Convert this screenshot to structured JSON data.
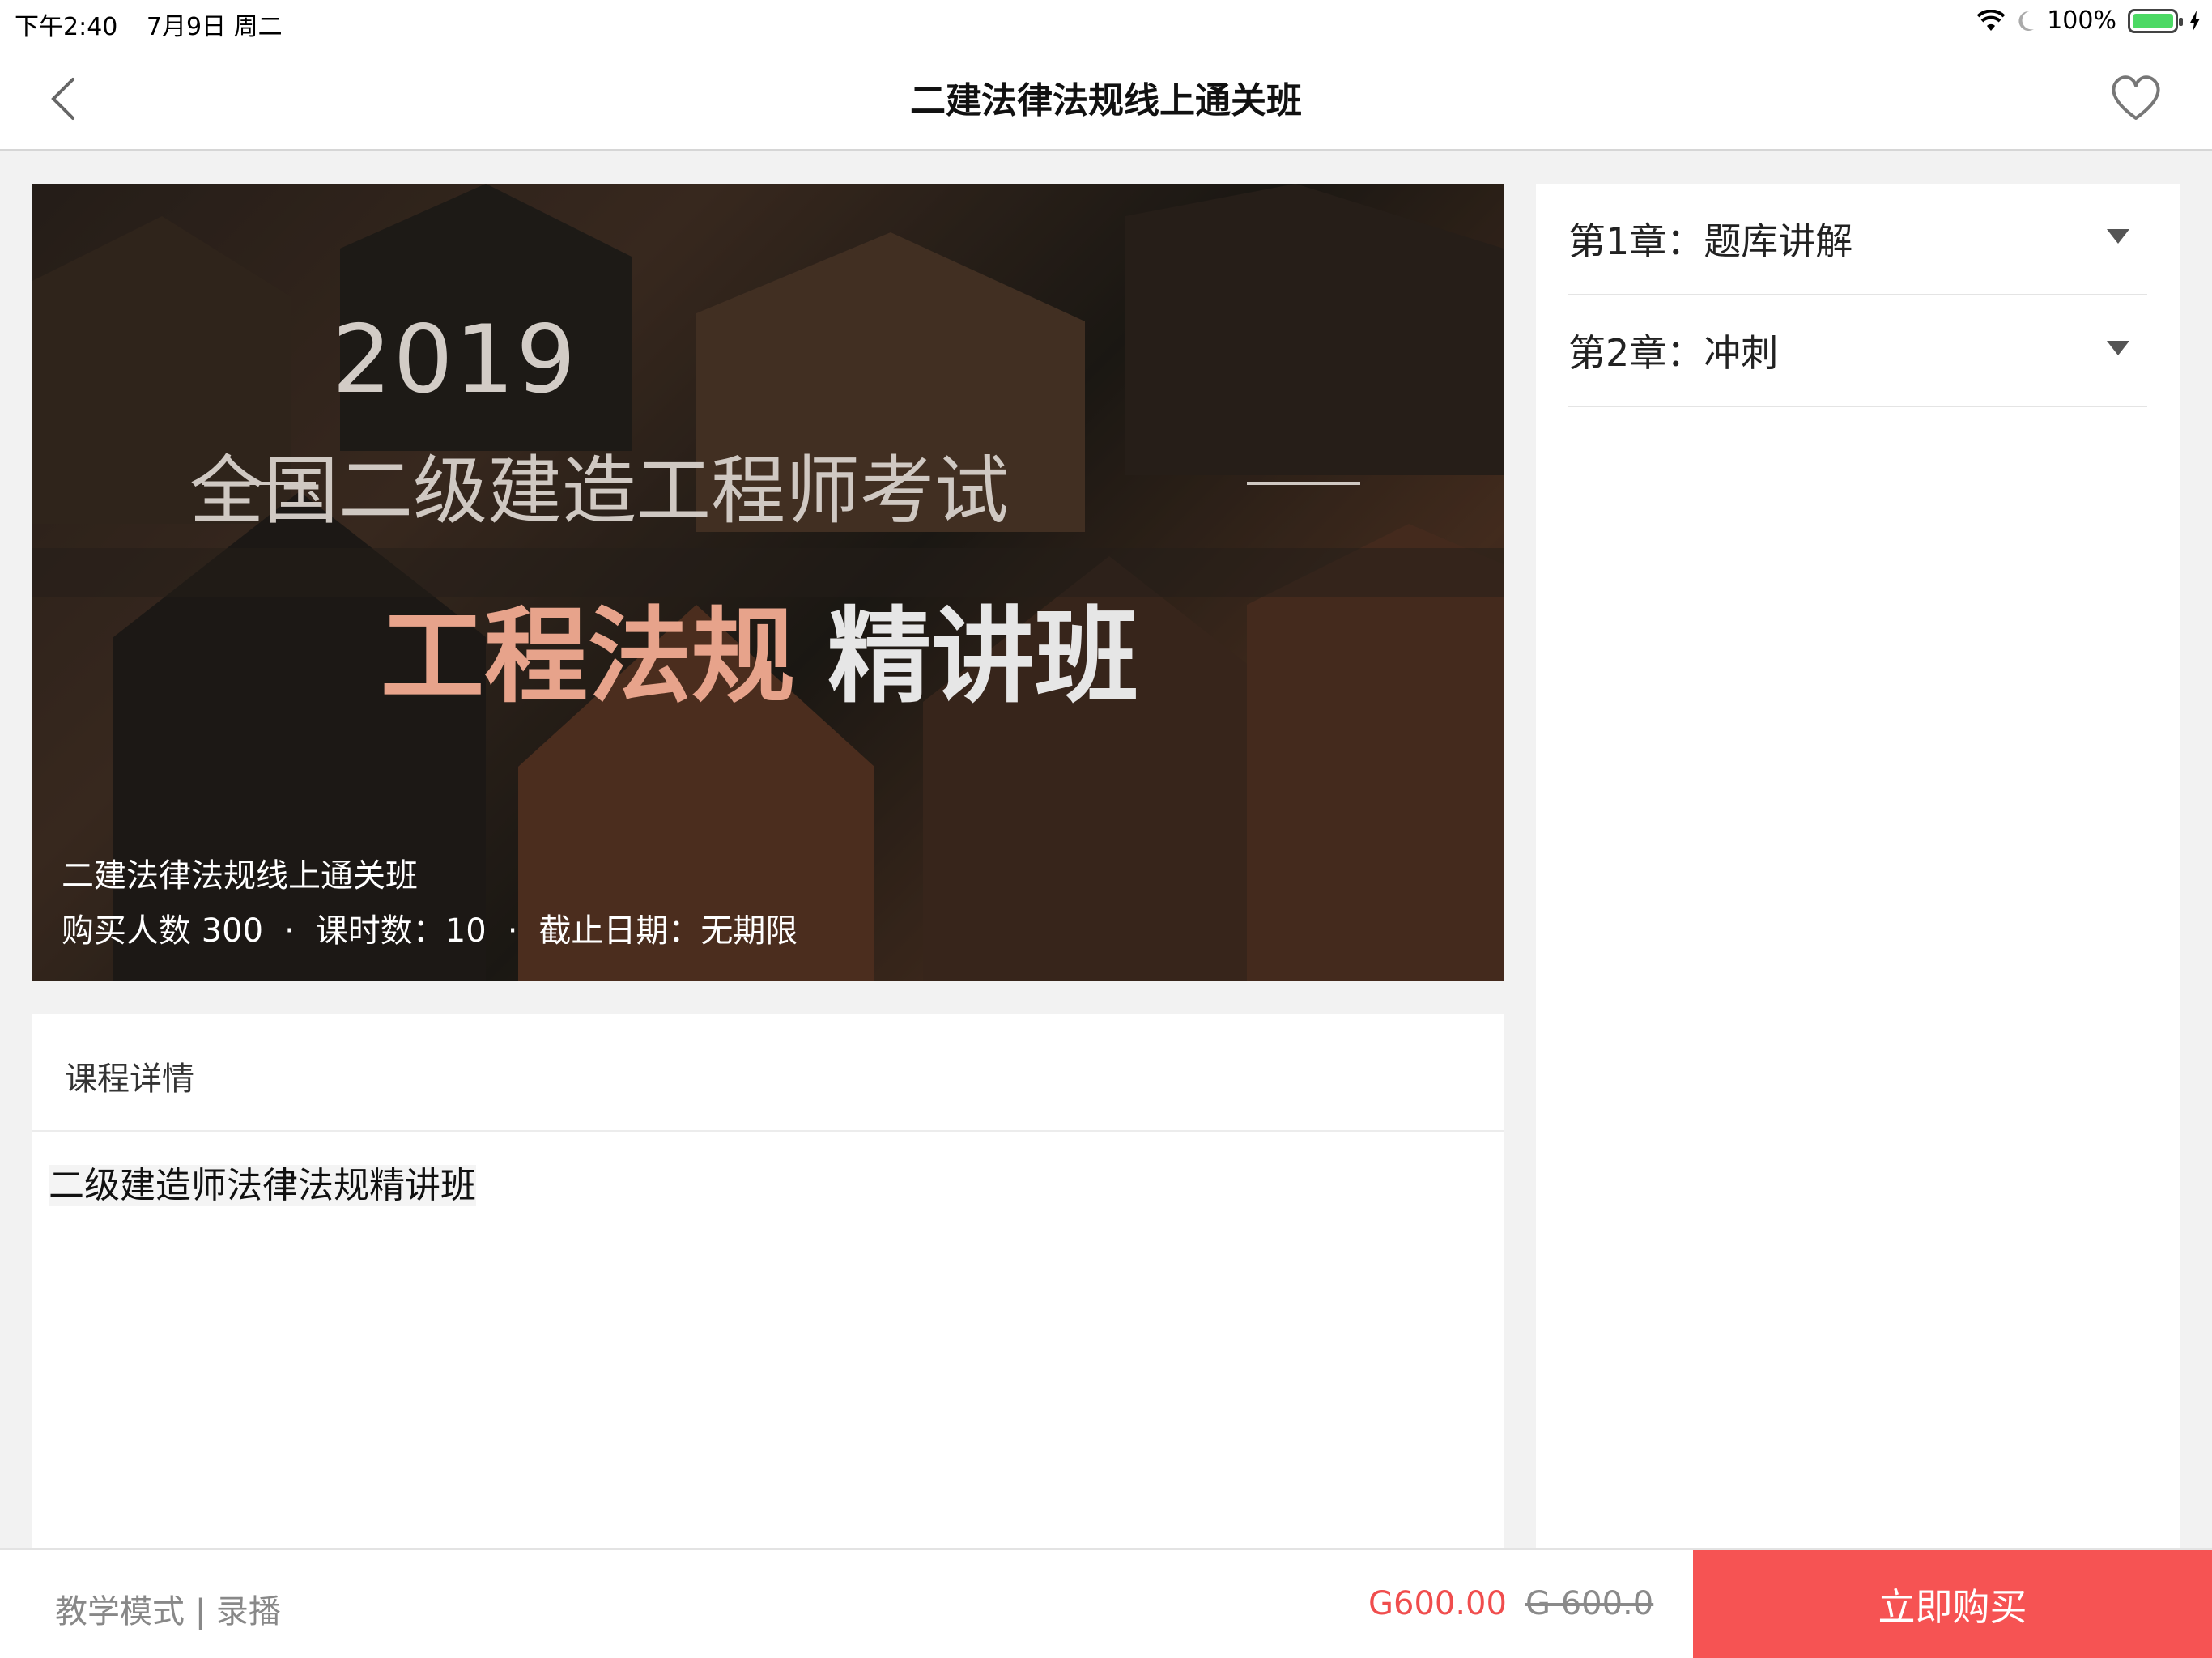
{
  "status_bar": {
    "time": "下午2:40",
    "date": "7月9日 周二",
    "battery": "100%"
  },
  "nav": {
    "title": "二建法律法规线上通关班",
    "back_icon": "chevron-left-icon",
    "favorite_icon": "heart-outline-icon"
  },
  "hero": {
    "banner_year": "2019",
    "banner_subtitle": "全国二级建造工程师考试",
    "banner_main_accent": "工程法规",
    "banner_main_plain": "精讲班",
    "course_name": "二建法律法规线上通关班",
    "buyers": "购买人数 300",
    "lessons": "课时数：10",
    "deadline": "截止日期：无期限",
    "separator": "·"
  },
  "detail": {
    "heading": "课程详情",
    "body": "二级建造师法律法规精讲班"
  },
  "chapters": [
    {
      "label": "第1章：题库讲解"
    },
    {
      "label": "第2章：冲刺"
    }
  ],
  "bottom": {
    "mode": "教学模式 | 录播",
    "price_now": "G600.00",
    "price_old": "G 600.0",
    "buy_label": "立即购买"
  },
  "colors": {
    "accent": "#f65353",
    "price": "#f04d4d",
    "banner_accent": "#e7a38b"
  }
}
